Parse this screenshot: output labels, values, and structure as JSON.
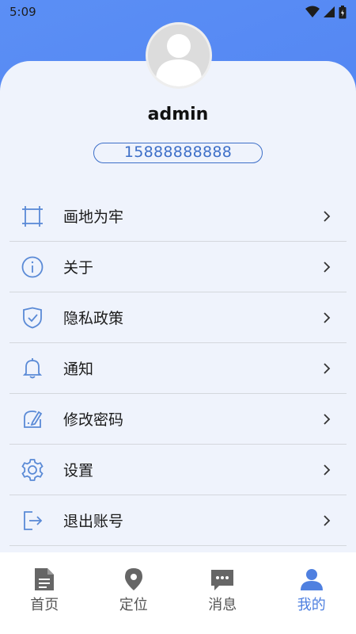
{
  "status_bar": {
    "time": "5:09"
  },
  "profile": {
    "username": "admin",
    "phone": "15888888888"
  },
  "menu": {
    "items": [
      {
        "label": "画地为牢",
        "icon": "crop-frame-icon"
      },
      {
        "label": "关于",
        "icon": "info-icon"
      },
      {
        "label": "隐私政策",
        "icon": "shield-check-icon"
      },
      {
        "label": "通知",
        "icon": "bell-icon"
      },
      {
        "label": "修改密码",
        "icon": "edit-password-icon"
      },
      {
        "label": "设置",
        "icon": "gear-icon"
      },
      {
        "label": "退出账号",
        "icon": "logout-icon"
      }
    ]
  },
  "bottom_nav": {
    "items": [
      {
        "label": "首页",
        "icon": "document-icon",
        "active": false
      },
      {
        "label": "定位",
        "icon": "location-pin-icon",
        "active": false
      },
      {
        "label": "消息",
        "icon": "chat-bubble-icon",
        "active": false
      },
      {
        "label": "我的",
        "icon": "person-icon",
        "active": true
      }
    ]
  },
  "colors": {
    "header_gradient": "#5b8ff5",
    "card_background": "#eff3fc",
    "accent": "#3d6fc8",
    "icon_blue": "#5a8ad6",
    "nav_active": "#4f80e0",
    "nav_inactive": "#666666"
  }
}
